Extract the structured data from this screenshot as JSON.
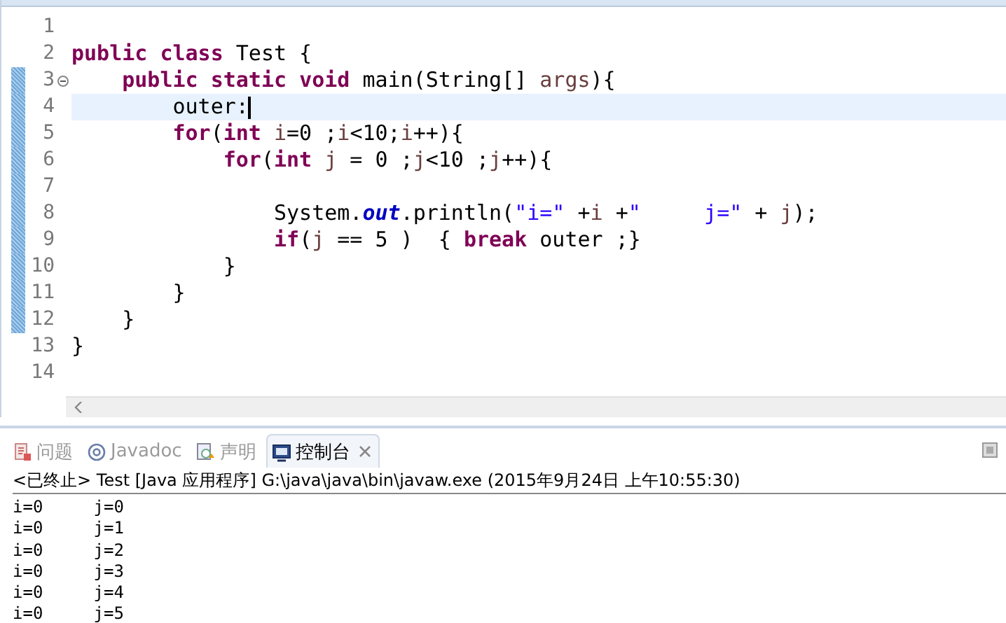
{
  "editor": {
    "lines": [
      {
        "number": "1",
        "current": false,
        "changed": false,
        "fold_marker": false
      },
      {
        "number": "2",
        "tokens": [
          {
            "kind": "keyword",
            "text": "public "
          },
          {
            "kind": "keyword",
            "text": "class"
          },
          {
            "kind": "plain",
            "text": " Test {"
          }
        ],
        "current": false,
        "changed": false,
        "fold_marker": false
      },
      {
        "number": "3",
        "tokens": [
          {
            "kind": "keyword",
            "text": "    public "
          },
          {
            "kind": "keyword",
            "text": "static "
          },
          {
            "kind": "keyword",
            "text": "void"
          },
          {
            "kind": "plain",
            "text": " main(String[] "
          },
          {
            "kind": "variable",
            "text": "args"
          },
          {
            "kind": "plain",
            "text": "){"
          }
        ],
        "current": false,
        "changed": true,
        "fold_marker": true
      },
      {
        "number": "4",
        "tokens": [
          {
            "kind": "plain",
            "text": "        outer:"
          }
        ],
        "current": true,
        "changed": true,
        "fold_marker": false
      },
      {
        "number": "5",
        "tokens": [
          {
            "kind": "keyword",
            "text": "        for"
          },
          {
            "kind": "plain",
            "text": "("
          },
          {
            "kind": "keyword",
            "text": "int "
          },
          {
            "kind": "variable",
            "text": "i"
          },
          {
            "kind": "plain",
            "text": "=0 ;"
          },
          {
            "kind": "variable",
            "text": "i"
          },
          {
            "kind": "plain",
            "text": "<10;"
          },
          {
            "kind": "variable",
            "text": "i"
          },
          {
            "kind": "plain",
            "text": "++){"
          }
        ],
        "current": false,
        "changed": true,
        "fold_marker": false
      },
      {
        "number": "6",
        "tokens": [
          {
            "kind": "keyword",
            "text": "            for"
          },
          {
            "kind": "plain",
            "text": "("
          },
          {
            "kind": "keyword",
            "text": "int "
          },
          {
            "kind": "variable",
            "text": "j"
          },
          {
            "kind": "plain",
            "text": " = 0 ;"
          },
          {
            "kind": "variable",
            "text": "j"
          },
          {
            "kind": "plain",
            "text": "<10 ;"
          },
          {
            "kind": "variable",
            "text": "j"
          },
          {
            "kind": "plain",
            "text": "++){"
          }
        ],
        "current": false,
        "changed": true,
        "fold_marker": false
      },
      {
        "number": "7",
        "current": false,
        "changed": true,
        "fold_marker": false
      },
      {
        "number": "8",
        "tokens": [
          {
            "kind": "plain",
            "text": "                System."
          },
          {
            "kind": "field",
            "text": "out"
          },
          {
            "kind": "plain",
            "text": ".println("
          },
          {
            "kind": "string",
            "text": "\"i=\""
          },
          {
            "kind": "plain",
            "text": " +"
          },
          {
            "kind": "variable",
            "text": "i"
          },
          {
            "kind": "plain",
            "text": " +"
          },
          {
            "kind": "string",
            "text": "\"     j=\""
          },
          {
            "kind": "plain",
            "text": " + "
          },
          {
            "kind": "variable",
            "text": "j"
          },
          {
            "kind": "plain",
            "text": ");"
          }
        ],
        "current": false,
        "changed": true,
        "fold_marker": false
      },
      {
        "number": "9",
        "tokens": [
          {
            "kind": "keyword",
            "text": "                if"
          },
          {
            "kind": "plain",
            "text": "("
          },
          {
            "kind": "variable",
            "text": "j"
          },
          {
            "kind": "plain",
            "text": " == 5 )  { "
          },
          {
            "kind": "keyword",
            "text": "break"
          },
          {
            "kind": "plain",
            "text": " outer ;}"
          }
        ],
        "current": false,
        "changed": true,
        "fold_marker": false
      },
      {
        "number": "10",
        "tokens": [
          {
            "kind": "plain",
            "text": "            }"
          }
        ],
        "current": false,
        "changed": true,
        "fold_marker": false
      },
      {
        "number": "11",
        "tokens": [
          {
            "kind": "plain",
            "text": "        }"
          }
        ],
        "current": false,
        "changed": true,
        "fold_marker": false
      },
      {
        "number": "12",
        "tokens": [
          {
            "kind": "plain",
            "text": "    }"
          }
        ],
        "current": false,
        "changed": true,
        "fold_marker": false
      },
      {
        "number": "13",
        "tokens": [
          {
            "kind": "plain",
            "text": "}"
          }
        ],
        "current": false,
        "changed": false,
        "fold_marker": false
      },
      {
        "number": "14",
        "current": false,
        "changed": false,
        "fold_marker": false
      }
    ]
  },
  "bottom_panel": {
    "tabs": [
      {
        "label": "问题",
        "kind": "problems",
        "selected": false,
        "closable": false
      },
      {
        "label": "Javadoc",
        "kind": "javadoc",
        "selected": false,
        "closable": false
      },
      {
        "label": "声明",
        "kind": "declaration",
        "selected": false,
        "closable": false
      },
      {
        "label": "控制台",
        "kind": "console",
        "selected": true,
        "closable": true
      }
    ],
    "console_header": "<已终止> Test [Java 应用程序] G:\\java\\java\\bin\\javaw.exe (2015年9月24日 上午10:55:30)",
    "output": [
      "i=0     j=0",
      "i=0     j=1",
      "i=0     j=2",
      "i=0     j=3",
      "i=0     j=4",
      "i=0     j=5"
    ]
  }
}
